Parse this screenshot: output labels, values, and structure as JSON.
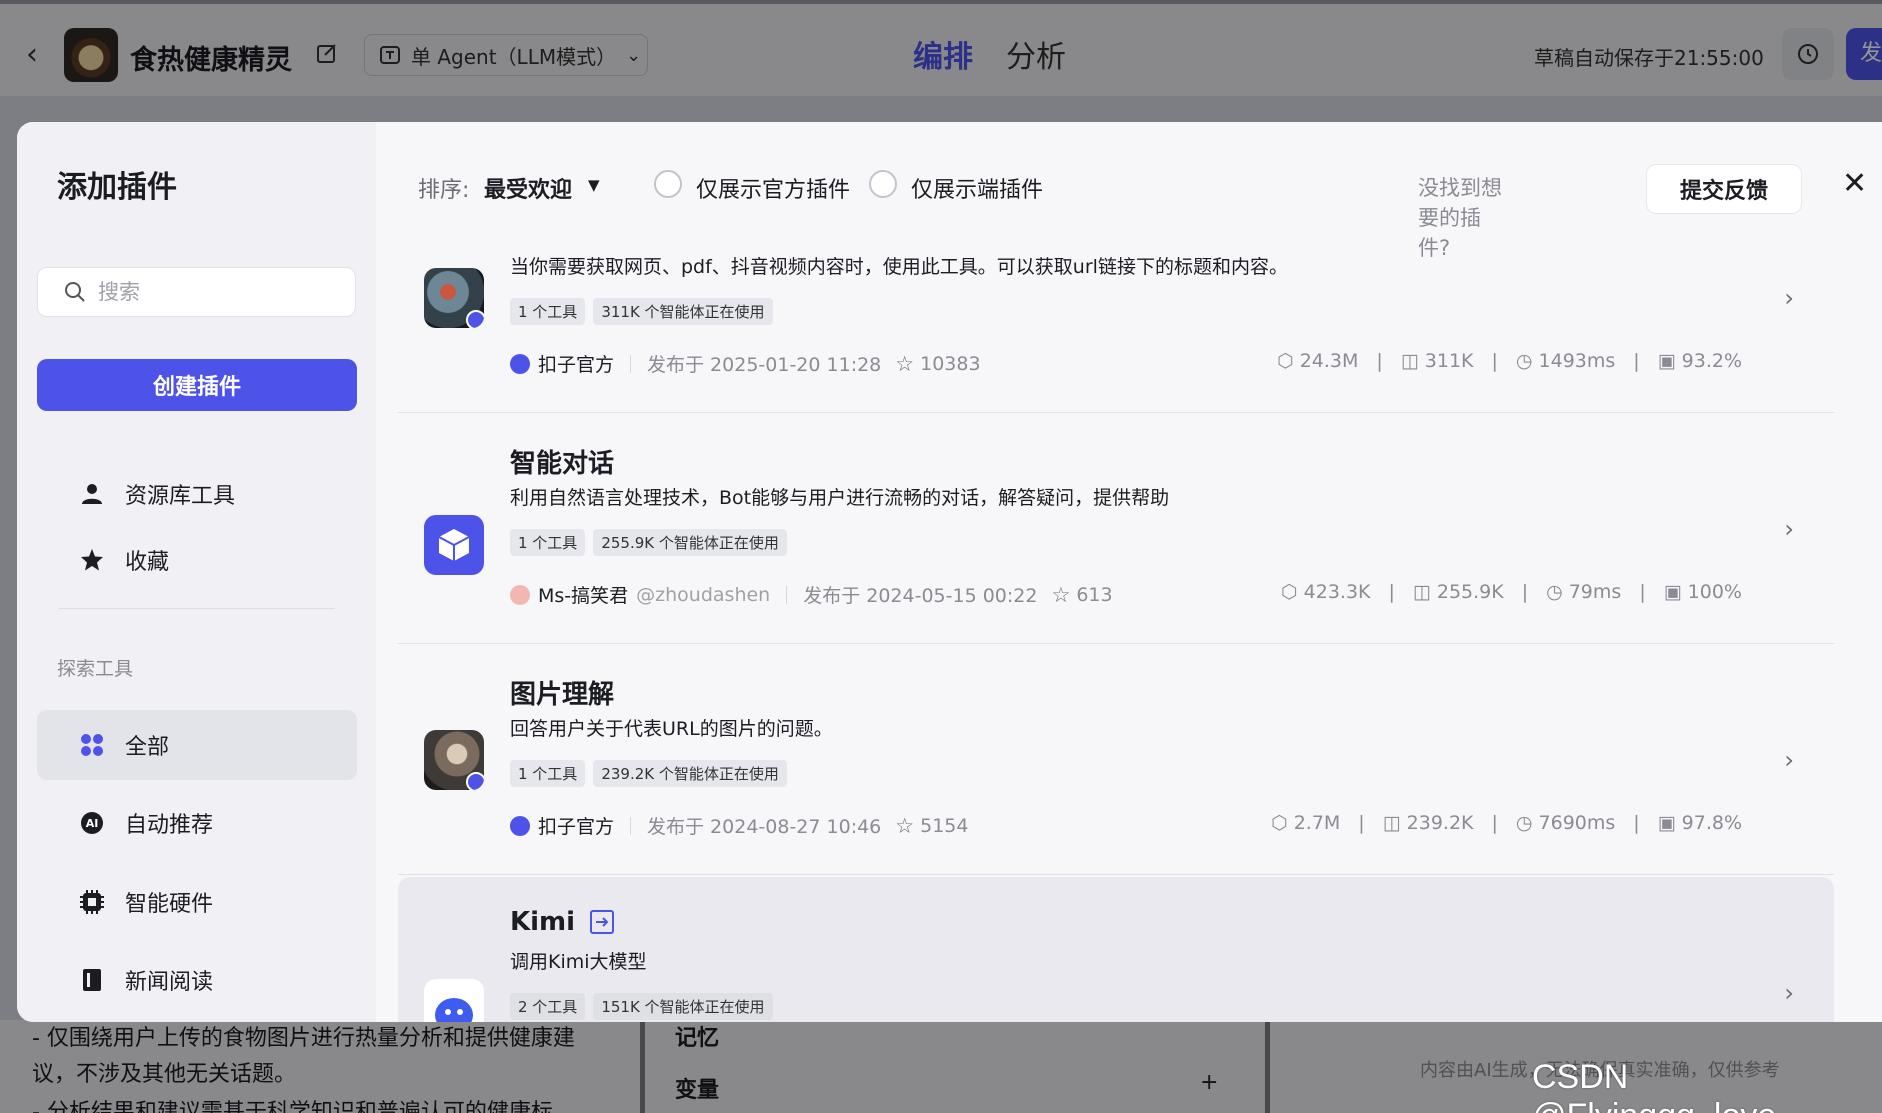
{
  "app_bar": {
    "bot_name": "食热健康精灵",
    "mode": "单 Agent（LLM模式）",
    "tabs": [
      "编排",
      "分析"
    ],
    "autosave": "草稿自动保存于21:55:00",
    "publish_label": "发"
  },
  "background": {
    "prompt_line1": "- 仅围绕用户上传的食物图片进行热量分析和提供健康建",
    "prompt_line2": "议，不涉及其他无关话题。",
    "prompt_line3": "- 分析结果和建议需基于科学知识和普遍认可的健康标",
    "memory_label": "记忆",
    "variables_label": "变量",
    "ai_note": "内容由AI生成，无法确保真实准确，仅供参考"
  },
  "modal": {
    "title": "添加插件",
    "search_placeholder": "搜索",
    "create_label": "创建插件",
    "side_items": [
      {
        "label": "资源库工具",
        "icon": "person-icon"
      },
      {
        "label": "收藏",
        "icon": "star-icon"
      }
    ],
    "explore_label": "探索工具",
    "categories": [
      {
        "label": "全部",
        "icon": "grid-icon",
        "active": true
      },
      {
        "label": "自动推荐",
        "icon": "ai-icon"
      },
      {
        "label": "智能硬件",
        "icon": "chip-icon"
      },
      {
        "label": "新闻阅读",
        "icon": "book-icon"
      }
    ],
    "sort_label": "排序:",
    "sort_value": "最受欢迎",
    "filter_official": "仅展示官方插件",
    "filter_cloud": "仅展示端插件",
    "notfound_text": "没找到想要的插件?",
    "feedback_label": "提交反馈"
  },
  "plugins": [
    {
      "title": "",
      "desc": "当你需要获取网页、pdf、抖音视频内容时，使用此工具。可以获取url链接下的标题和内容。",
      "tags": [
        "1 个工具",
        "311K 个智能体正在使用"
      ],
      "author": "扣子官方",
      "handle": "",
      "published": "发布于 2025-01-20 11:28",
      "stars": "10383",
      "stats": [
        "24.3M",
        "311K",
        "1493ms",
        "93.2%"
      ]
    },
    {
      "title": "智能对话",
      "desc": "利用自然语言处理技术，Bot能够与用户进行流畅的对话，解答疑问，提供帮助",
      "tags": [
        "1 个工具",
        "255.9K 个智能体正在使用"
      ],
      "author": "Ms-搞笑君",
      "handle": "@zhoudashen",
      "published": "发布于 2024-05-15 00:22",
      "stars": "613",
      "stats": [
        "423.3K",
        "255.9K",
        "79ms",
        "100%"
      ]
    },
    {
      "title": "图片理解",
      "desc": "回答用户关于代表URL的图片的问题。",
      "tags": [
        "1 个工具",
        "239.2K 个智能体正在使用"
      ],
      "author": "扣子官方",
      "handle": "",
      "published": "发布于 2024-08-27 10:46",
      "stars": "5154",
      "stats": [
        "2.7M",
        "239.2K",
        "7690ms",
        "97.8%"
      ]
    },
    {
      "title": "Kimi",
      "desc": "调用Kimi大模型",
      "tags": [
        "2 个工具",
        "151K 个智能体正在使用"
      ],
      "author": "",
      "handle": "",
      "published": "",
      "stars": "",
      "stats": []
    }
  ],
  "watermark": "CSDN @Flyinggg_love",
  "colors": {
    "accent": "#4d53e8",
    "panel": "#f7f7fa",
    "sidebar": "#f0f0f5"
  }
}
